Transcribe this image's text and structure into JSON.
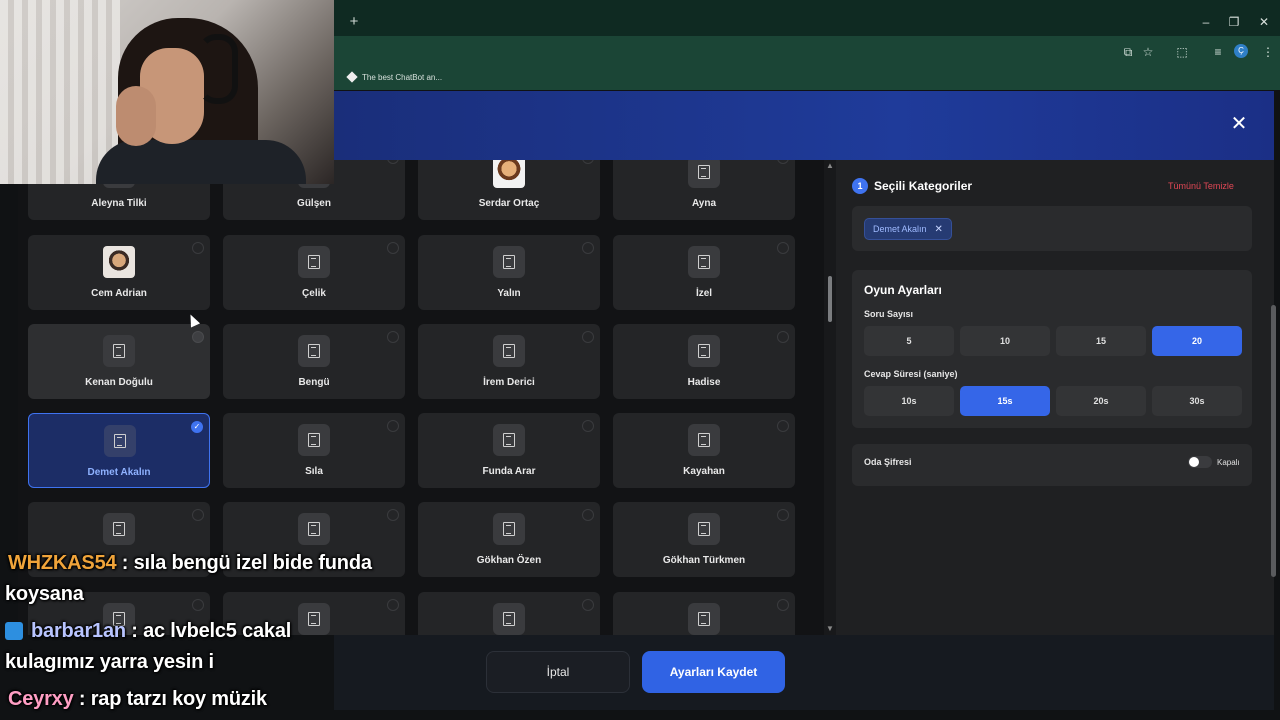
{
  "browser": {
    "new_tab_glyph": "+",
    "window_controls": [
      "–",
      "❐",
      "✕"
    ],
    "toolbar_icons": [
      "cast-icon",
      "star-icon",
      "extensions-icon",
      "media-icon",
      "profile-icon",
      "menu-icon"
    ],
    "toolbar_glyphs": [
      "⧉",
      "☆",
      "⬚",
      "≡",
      "⋮"
    ],
    "profile_letter": "Ç",
    "bookmark_label": "The best ChatBot an..."
  },
  "modal": {
    "close_glyph": "✕"
  },
  "grid": {
    "cards": [
      {
        "name": "Aleyna Tilki",
        "type": "icon"
      },
      {
        "name": "Gülşen",
        "type": "icon"
      },
      {
        "name": "Serdar Ortaç",
        "type": "avatar-a"
      },
      {
        "name": "Ayna",
        "type": "icon"
      },
      {
        "name": "Cem Adrian",
        "type": "avatar-b"
      },
      {
        "name": "Çelik",
        "type": "icon"
      },
      {
        "name": "Yalın",
        "type": "icon"
      },
      {
        "name": "İzel",
        "type": "icon"
      },
      {
        "name": "Kenan Doğulu",
        "type": "icon",
        "state": "hover"
      },
      {
        "name": "Bengü",
        "type": "icon"
      },
      {
        "name": "İrem Derici",
        "type": "icon"
      },
      {
        "name": "Hadise",
        "type": "icon"
      },
      {
        "name": "Demet Akalın",
        "type": "icon",
        "state": "selected"
      },
      {
        "name": "Sıla",
        "type": "icon"
      },
      {
        "name": "Funda Arar",
        "type": "icon"
      },
      {
        "name": "Kayahan",
        "type": "icon"
      },
      {
        "name": "",
        "type": "icon"
      },
      {
        "name": "",
        "type": "icon"
      },
      {
        "name": "Gökhan Özen",
        "type": "icon"
      },
      {
        "name": "Gökhan Türkmen",
        "type": "icon"
      },
      {
        "name": "",
        "type": "icon"
      },
      {
        "name": "",
        "type": "icon"
      },
      {
        "name": "",
        "type": "icon"
      },
      {
        "name": "",
        "type": "icon"
      }
    ],
    "selected_check": "✓"
  },
  "selected": {
    "step": "1",
    "title": "Seçili Kategoriler",
    "clear_all": "Tümünü Temizle",
    "chip_label": "Demet Akalın",
    "chip_remove": "✕"
  },
  "settings": {
    "title": "Oyun Ayarları",
    "question_count_label": "Soru Sayısı",
    "question_counts": [
      "5",
      "10",
      "15",
      "20"
    ],
    "question_count_selected": "20",
    "answer_time_label": "Cevap Süresi (saniye)",
    "answer_times": [
      "10s",
      "15s",
      "20s",
      "30s"
    ],
    "answer_time_selected": "15s"
  },
  "password": {
    "label": "Oda Şifresi",
    "toggle_state": "Kapalı"
  },
  "footer": {
    "cancel": "İptal",
    "save": "Ayarları Kaydet"
  },
  "chat": [
    {
      "user": "WHZKAS54",
      "line1": " : sıla bengü izel bide funda",
      "line2": "koysana"
    },
    {
      "user": "barbar1an",
      "line1": " : ac lvbelc5 cakal",
      "line2": "kulagımız yarra yesin i"
    },
    {
      "user": "Ceyrxy",
      "line1": " : rap tarzı koy müzik"
    }
  ],
  "colors": {
    "accent": "#3566e8",
    "danger": "#e04755",
    "modal_header": "#1f3b9a",
    "browser_frame": "#1b4536"
  }
}
